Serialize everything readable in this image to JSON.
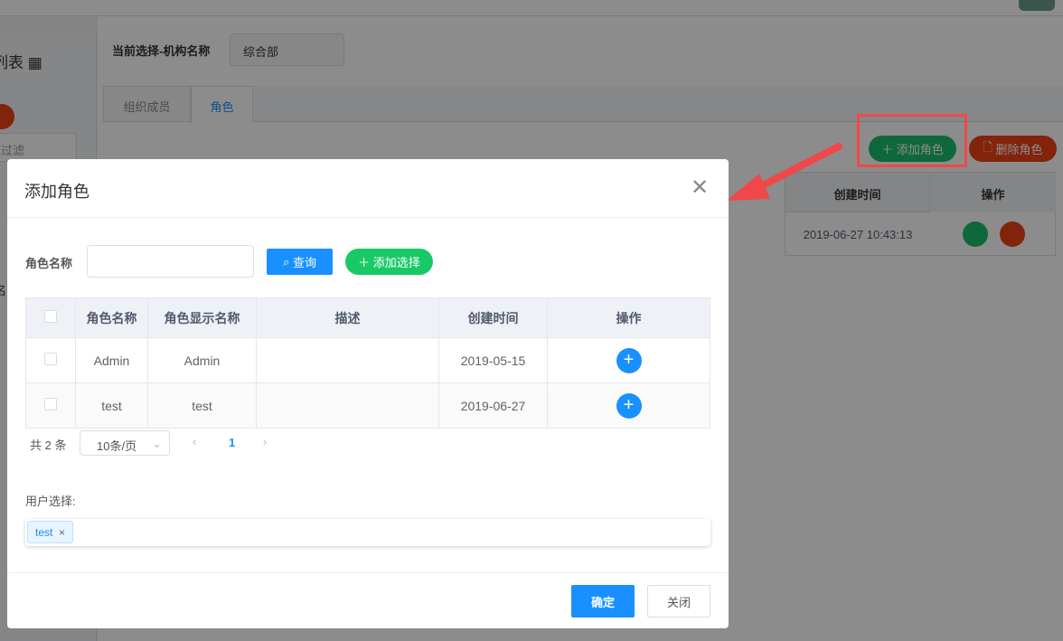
{
  "page": {
    "sidebar_title": "列表",
    "filter_placeholder": "过滤",
    "side_char": "名",
    "org_label": "当前选择-机构名称",
    "org_value": "综合部",
    "tabs": [
      {
        "label": "组织成员",
        "active": false
      },
      {
        "label": "角色",
        "active": true
      }
    ],
    "add_role": "添加角色",
    "delete_role": "删除角色",
    "bg_table": {
      "headers": [
        "创建时间",
        "操作"
      ],
      "rows": [
        {
          "created": "2019-06-27 10:43:13"
        }
      ]
    }
  },
  "modal": {
    "title": "添加角色",
    "search_label": "角色名称",
    "search_value": "",
    "query": "查询",
    "add_selected": "添加选择",
    "columns": [
      "",
      "角色名称",
      "角色显示名称",
      "描述",
      "创建时间",
      "操作"
    ],
    "rows": [
      {
        "name": "Admin",
        "display": "Admin",
        "desc": "",
        "created": "2019-05-15"
      },
      {
        "name": "test",
        "display": "test",
        "desc": "",
        "created": "2019-06-27"
      }
    ],
    "total": "共 2 条",
    "page_size": "10条/页",
    "current_page": "1",
    "user_select_label": "用户选择:",
    "tags": [
      "test"
    ],
    "ok": "确定",
    "close": "关闭"
  },
  "colors": {
    "primary": "#1890ff",
    "success": "#19be6b",
    "danger": "#ed4014",
    "annotation": "#f04848"
  }
}
